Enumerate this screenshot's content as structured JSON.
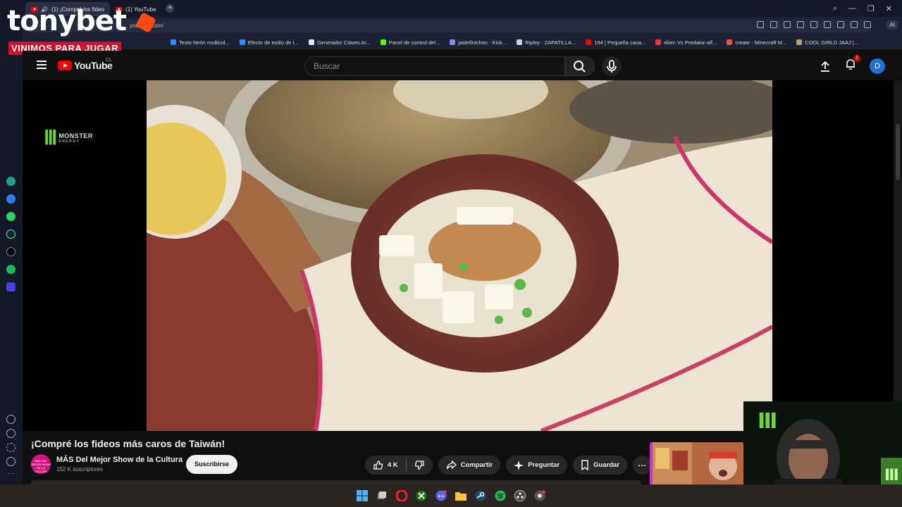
{
  "browser": {
    "tabs": [
      {
        "label": "(1) ¡Compré los fideo"
      },
      {
        "label": "(1) YouTube"
      }
    ],
    "url": "youtube.com/",
    "ai_label": "AI",
    "bookmarks": [
      {
        "label": "Texto Neón multicol...",
        "color": "#2a8cff"
      },
      {
        "label": "Efecto de estilo de t...",
        "color": "#2a8cff"
      },
      {
        "label": "Generador Claves Ar...",
        "color": "#e8e8e8"
      },
      {
        "label": "Panel de control del...",
        "color": "#53fc18"
      },
      {
        "label": "jaidefinichon - Kick...",
        "color": "#8a8aff"
      },
      {
        "label": "Ripley - ZAPATILLA...",
        "color": "#d0d0d0"
      },
      {
        "label": "194 | Pequeña casa...",
        "color": "#ff0000"
      },
      {
        "label": "Alien Vs Predator-alf...",
        "color": "#ff3030"
      },
      {
        "label": "create - Minecraft M...",
        "color": "#ff4a4a"
      },
      {
        "label": "COOL GIRLD JAAJ |...",
        "color": "#c0a070"
      }
    ]
  },
  "overlay": {
    "brand": "tonybet",
    "tagline": "VINIMOS PARA JUGAR",
    "accent": "#ff4a14",
    "tag_color": "#d4102b"
  },
  "youtube": {
    "logo_text": "YouTube",
    "region": "CL",
    "search_placeholder": "Buscar",
    "notification_count": "1",
    "avatar_letter": "D"
  },
  "player": {
    "sponsor_name": "MONSTER",
    "sponsor_sub": "ENERGY"
  },
  "video": {
    "title": "¡Compré los fideos más caros de Taiwán!",
    "channel_name": "MÁS Del Mejor Show de la Cultura",
    "channel_avatar_text": "MÁS DEL MEJOR SHOW DE LA CULTURA",
    "subscribers": "152 K suscriptores",
    "subscribe_label": "Suscribirse",
    "likes": "4 K",
    "share_label": "Compartir",
    "ask_label": "Preguntar",
    "save_label": "Guardar"
  },
  "sidebar_icons": [
    "chatgpt-icon",
    "messenger-icon",
    "whatsapp-icon",
    "tiktok-icon",
    "x-icon",
    "spotify-icon",
    "player-icon"
  ],
  "taskbar_icons": [
    "windows-icon",
    "task-view-icon",
    "opera-icon",
    "xbox-icon",
    "discord-icon",
    "folder-icon",
    "steam-icon",
    "spotify-icon",
    "obs-icon",
    "chrome-icon"
  ]
}
